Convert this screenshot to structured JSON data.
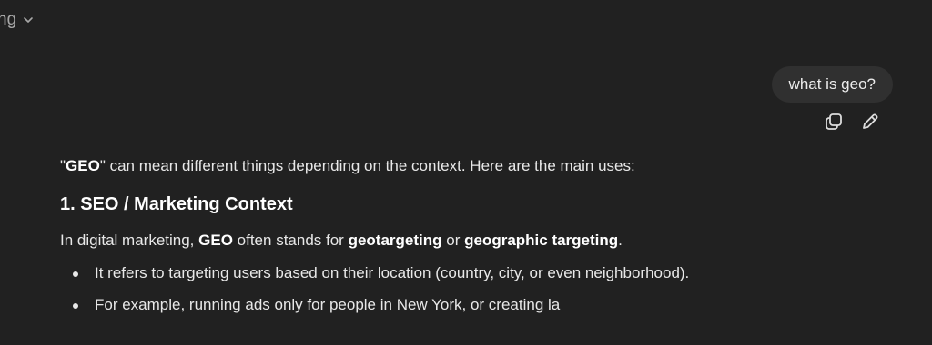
{
  "header": {
    "model_label": "ng",
    "icons": {
      "dropdown": "chevron-down-icon"
    }
  },
  "user_message": {
    "text": "what is geo?",
    "actions": [
      {
        "name": "copy-icon"
      },
      {
        "name": "edit-icon"
      }
    ]
  },
  "assistant_message": {
    "intro_quote_open": "\"",
    "intro_bold": "GEO",
    "intro_rest": "\" can mean different things depending on the context. Here are the main uses:",
    "section_title": "1. SEO / Marketing Context",
    "para_prefix": "In digital marketing, ",
    "para_bold1": "GEO",
    "para_mid1": " often stands for ",
    "para_bold2": "geotargeting",
    "para_mid2": " or ",
    "para_bold3": "geographic targeting",
    "para_end": ".",
    "bullets": [
      "It refers to targeting users based on their location (country, city, or even neighborhood).",
      "For example, running ads only for people in New York, or creating la"
    ]
  },
  "colors": {
    "background": "#212121",
    "bubble": "#303030",
    "text": "#ececec",
    "muted": "#a8a8a8"
  }
}
